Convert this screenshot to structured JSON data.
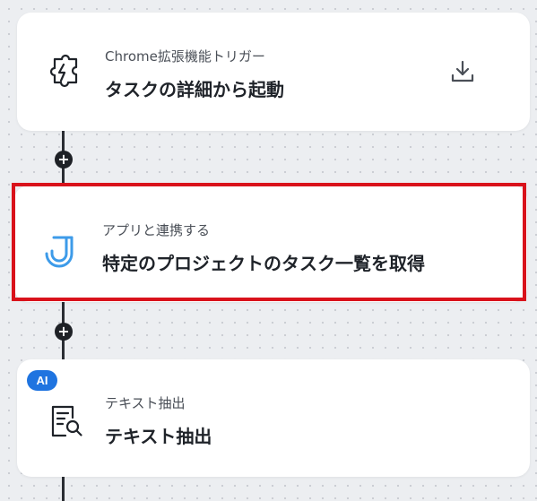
{
  "flow": {
    "steps": [
      {
        "subtitle": "Chrome拡張機能トリガー",
        "title": "タスクの詳細から起動",
        "icon": "puzzle-icon",
        "action_icon": "download-icon"
      },
      {
        "subtitle": "アプリと連携する",
        "title": "特定のプロジェクトのタスク一覧を取得",
        "icon": "jooto-app-icon",
        "highlighted": true,
        "highlight_color": "#d9121b"
      },
      {
        "subtitle": "テキスト抽出",
        "title": "テキスト抽出",
        "icon": "document-search-icon",
        "badge": "AI",
        "badge_color": "#1f74e0"
      }
    ],
    "add_button_label": "+"
  }
}
